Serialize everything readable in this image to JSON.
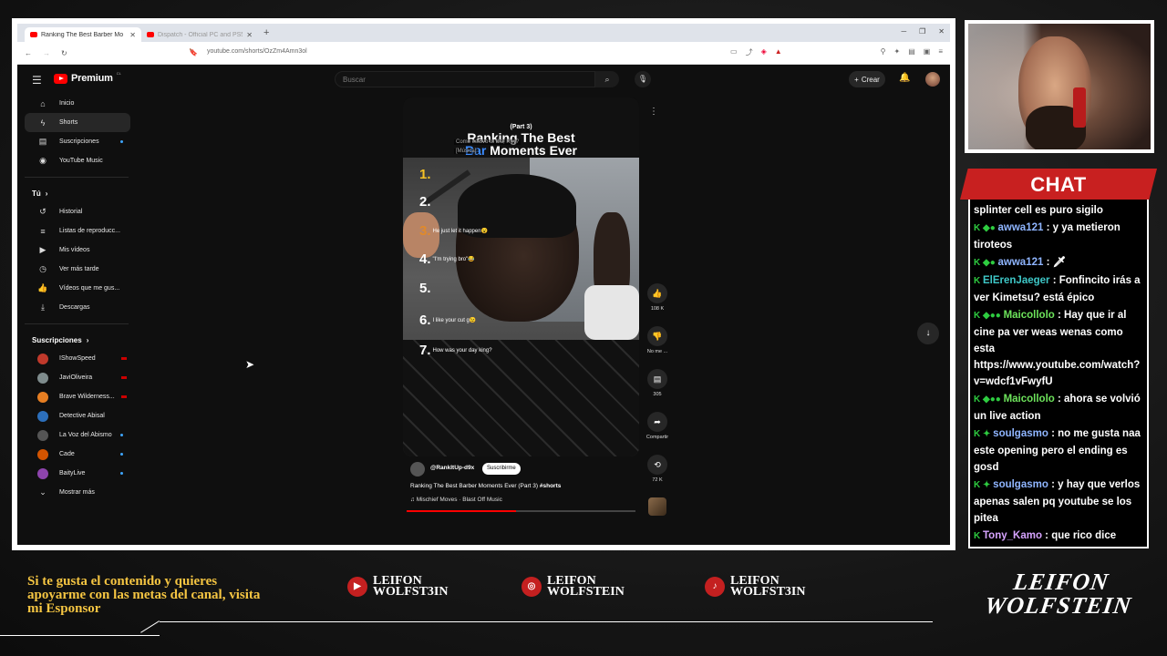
{
  "browser": {
    "tabs": [
      {
        "title": "Ranking The Best Barber Mo",
        "active": true
      },
      {
        "title": "Dispatch - Official PC and PS5 Relea",
        "active": false
      }
    ],
    "url": "youtube.com/shorts/OzZm4Amn3ol"
  },
  "youtube": {
    "logo_text": "Premium",
    "logo_sup": "CL",
    "search_placeholder": "Buscar",
    "create_label": "Crear",
    "sidebar": {
      "main": [
        {
          "label": "Inicio",
          "icon": "home-icon"
        },
        {
          "label": "Shorts",
          "icon": "shorts-icon",
          "active": true
        },
        {
          "label": "Suscripciones",
          "icon": "subscriptions-icon",
          "dot": true
        },
        {
          "label": "YouTube Music",
          "icon": "music-icon"
        }
      ],
      "you_header": "Tú",
      "you": [
        {
          "label": "Historial",
          "icon": "history-icon"
        },
        {
          "label": "Listas de reproducc...",
          "icon": "playlist-icon"
        },
        {
          "label": "Mis vídeos",
          "icon": "my-videos-icon"
        },
        {
          "label": "Ver más tarde",
          "icon": "watch-later-icon"
        },
        {
          "label": "Vídeos que me gus...",
          "icon": "like-icon"
        },
        {
          "label": "Descargas",
          "icon": "download-icon"
        }
      ],
      "subs_header": "Suscripciones",
      "subs": [
        {
          "label": "IShowSpeed",
          "live": true,
          "color": "#c0392b"
        },
        {
          "label": "JaviOliveira",
          "live": true,
          "color": "#7f8c8d"
        },
        {
          "label": "Brave Wilderness...",
          "live": true,
          "color": "#e67e22"
        },
        {
          "label": "Detective Abisal",
          "live": false,
          "color": "#2c6fbb"
        },
        {
          "label": "La Voz del Abismo",
          "dot": true,
          "color": "#555555"
        },
        {
          "label": "Cade",
          "dot": true,
          "color": "#d35400"
        },
        {
          "label": "BaityLive",
          "dot": true,
          "color": "#8e44ad"
        }
      ],
      "show_more": "Mostrar más"
    },
    "short": {
      "part": "(Part 3)",
      "title_line1": "Ranking The Best",
      "title_line2_a": "Bar",
      "title_line2_b": " Moments Ever",
      "caption1": "Como estuvo tu día, Rey?",
      "caption2": "[Música]",
      "ranks": [
        {
          "num": "1.",
          "text": "",
          "style": "gold"
        },
        {
          "num": "2.",
          "text": "",
          "style": ""
        },
        {
          "num": "3.",
          "text": "He just let it happen😮",
          "style": "bronze"
        },
        {
          "num": "4.",
          "text": "\"I'm trying bro\"😂",
          "style": ""
        },
        {
          "num": "5.",
          "text": "",
          "style": ""
        },
        {
          "num": "6.",
          "text": "I like your cut g😉",
          "style": ""
        },
        {
          "num": "7.",
          "text": "How was your day king?",
          "style": ""
        }
      ],
      "channel": "@RankItUp-d9x",
      "subscribe": "Suscribirme",
      "video_title": "Ranking The Best Barber Moments Ever (Part 3)",
      "video_tag": "#shorts",
      "music": "Mischief Moves · Blast Off Music",
      "progress": 0.48
    },
    "rail": {
      "likes": "108 K",
      "dislike": "No me ...",
      "comments": "305",
      "share": "Compartir",
      "remix": "72 K"
    }
  },
  "chat": {
    "title": "CHAT",
    "messages": [
      {
        "user": "",
        "text": "splinter cell es puro sigilo",
        "color": "#ffffff"
      },
      {
        "user": "awwa121",
        "text": ": y ya metieron tiroteos",
        "color": "#8fb5ff"
      },
      {
        "user": "awwa121",
        "text": ": 🗡",
        "color": "#8fb5ff"
      },
      {
        "user": "ElErenJaeger",
        "text": ": Fonfincito irás a ver Kimetsu? está épico",
        "color": "#3ec7c7"
      },
      {
        "user": "Maicollolo",
        "text": ": Hay que ir al cine pa ver weas wenas como esta https://www.youtube.com/watch?v=wdcf1vFwyfU",
        "color": "#6de35b"
      },
      {
        "user": "Maicollolo",
        "text": ": ahora se volvió un live action",
        "color": "#6de35b"
      },
      {
        "user": "soulgasmo",
        "text": ": no me gusta naa este opening pero el ending es gosd",
        "color": "#8fb5ff"
      },
      {
        "user": "soulgasmo",
        "text": ": y hay que verlos apenas salen pq youtube se los pitea",
        "color": "#8fb5ff"
      },
      {
        "user": "Tony_Kamo",
        "text": ": que rico dice asjksaj",
        "color": "#d6a3ff"
      }
    ]
  },
  "overlay": {
    "support_text": "Si te gusta el contenido y quieres apoyarme con las metas del canal, visita mi Esponsor",
    "socials": [
      {
        "network": "youtube-icon",
        "line1": "LEIFON",
        "line2": "WOLFST3IN"
      },
      {
        "network": "instagram-icon",
        "line1": "LEIFON",
        "line2": "WOLFSTEIN"
      },
      {
        "network": "tiktok-icon",
        "line1": "LEIFON",
        "line2": "WOLFST3IN"
      }
    ],
    "brand_line1": "LEIFON",
    "brand_line2": "WOLFSTEIN"
  }
}
